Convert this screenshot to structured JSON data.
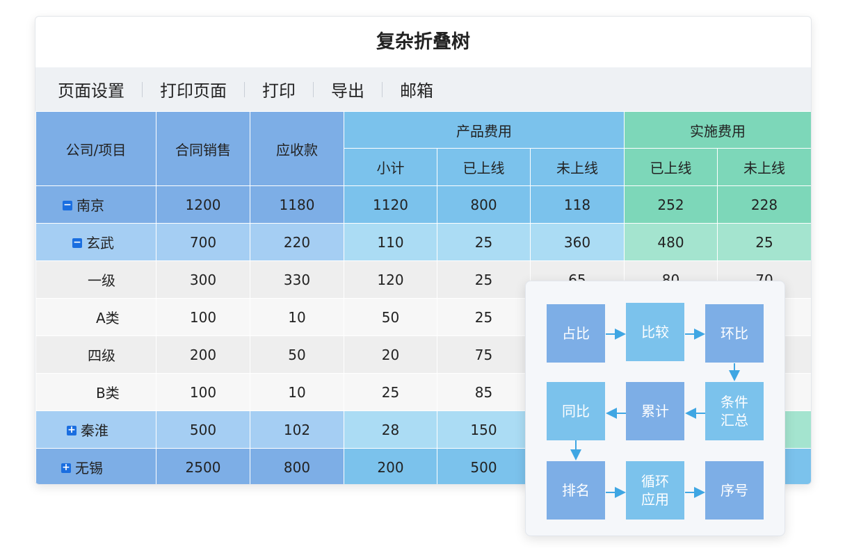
{
  "title": "复杂折叠树",
  "toolbar": [
    "页面设置",
    "打印页面",
    "打印",
    "导出",
    "邮箱"
  ],
  "headers": {
    "company": "公司/项目",
    "contract": "合同销售",
    "receivable": "应收款",
    "product_cost": "产品费用",
    "impl_cost": "实施费用",
    "subtotal": "小计",
    "online": "已上线",
    "offline": "未上线",
    "impl_online": "已上线",
    "impl_offline": "未上线"
  },
  "rows": [
    {
      "name": "南京",
      "toggle": "−",
      "values": [
        "1200",
        "1180",
        "1120",
        "800",
        "118",
        "252",
        "228"
      ]
    },
    {
      "name": "玄武",
      "toggle": "−",
      "values": [
        "700",
        "220",
        "110",
        "25",
        "360",
        "480",
        "25"
      ]
    },
    {
      "name": "一级",
      "values": [
        "300",
        "330",
        "120",
        "25",
        "65",
        "80",
        "70"
      ]
    },
    {
      "name": "A类",
      "values": [
        "100",
        "10",
        "50",
        "25",
        "",
        "",
        ""
      ]
    },
    {
      "name": "四级",
      "values": [
        "200",
        "50",
        "20",
        "75",
        "",
        "",
        ""
      ]
    },
    {
      "name": "B类",
      "values": [
        "100",
        "10",
        "25",
        "85",
        "",
        "",
        ""
      ]
    },
    {
      "name": "秦淮",
      "toggle": "+",
      "values": [
        "500",
        "102",
        "28",
        "150",
        "",
        "",
        ""
      ]
    },
    {
      "name": "无锡",
      "toggle": "+",
      "values": [
        "2500",
        "800",
        "200",
        "500",
        "",
        "",
        ""
      ]
    }
  ],
  "flow": {
    "zhanbi": "占比",
    "bijiao": "比较",
    "huanbi": "环比",
    "tongbi": "同比",
    "leiji": "累计",
    "tiaojian": "条件汇总",
    "paiming": "排名",
    "xunhuan": "循环应用",
    "xuhao": "序号"
  },
  "colors": {
    "blue": "#7daee6",
    "sky": "#7bc2ec",
    "green": "#7dd7b9",
    "toggle": "#1a6ee0",
    "arrow": "#3fa6e3"
  }
}
